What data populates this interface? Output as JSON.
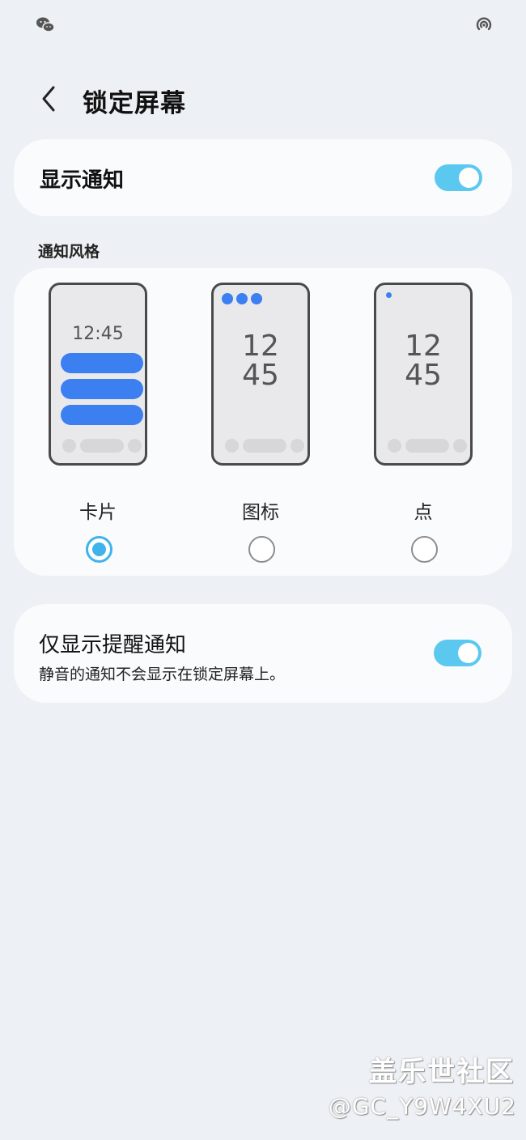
{
  "status_bar": {
    "left_icon": "wechat-icon",
    "right_icon": "hotspot-icon"
  },
  "header": {
    "back_icon": "chevron-left-icon",
    "title": "锁定屏幕"
  },
  "show_notifications": {
    "label": "显示通知",
    "enabled": true
  },
  "notification_style": {
    "section_title": "通知风格",
    "options": [
      {
        "label": "卡片",
        "selected": true,
        "preview_time": "12:45"
      },
      {
        "label": "图标",
        "selected": false,
        "preview_hour": "12",
        "preview_minute": "45"
      },
      {
        "label": "点",
        "selected": false,
        "preview_hour": "12",
        "preview_minute": "45"
      }
    ]
  },
  "alert_only": {
    "title": "仅显示提醒通知",
    "subtitle": "静音的通知不会显示在锁定屏幕上。",
    "enabled": true
  },
  "watermark": {
    "line1": "盖乐世社区",
    "line2": "@GC_Y9W4XU2"
  },
  "colors": {
    "accent": "#5bc8f0",
    "radio": "#3fb3ea",
    "preview_blue": "#3b7ff0",
    "background": "#edf0f4"
  }
}
